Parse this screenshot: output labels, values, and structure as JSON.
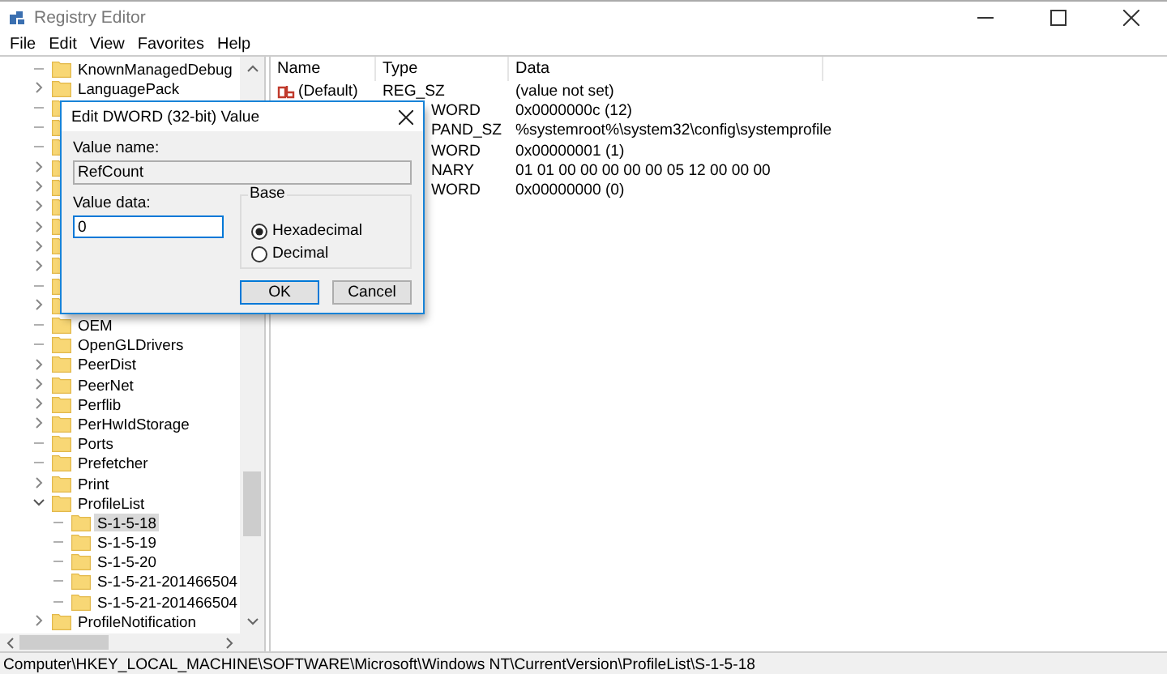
{
  "window": {
    "title": "Registry Editor"
  },
  "menu": [
    "File",
    "Edit",
    "View",
    "Favorites",
    "Help"
  ],
  "tree": {
    "items": [
      {
        "label": "KnownManagedDebug",
        "expandable": false,
        "selected": false
      },
      {
        "label": "LanguagePack",
        "expandable": true,
        "expanded": false,
        "selected": false
      },
      {
        "expandable": false,
        "selected": false
      },
      {
        "expandable": false,
        "selected": false
      },
      {
        "expandable": false,
        "selected": false
      },
      {
        "expandable": true,
        "expanded": false,
        "selected": false
      },
      {
        "expandable": true,
        "expanded": false,
        "selected": false
      },
      {
        "expandable": true,
        "expanded": false,
        "selected": false
      },
      {
        "expandable": true,
        "expanded": false,
        "selected": false
      },
      {
        "expandable": true,
        "expanded": false,
        "selected": false
      },
      {
        "expandable": true,
        "expanded": false,
        "selected": false
      },
      {
        "expandable": false,
        "selected": false
      },
      {
        "expandable": true,
        "expanded": false,
        "selected": false
      },
      {
        "label": "OEM",
        "expandable": false,
        "selected": false
      },
      {
        "label": "OpenGLDrivers",
        "expandable": false,
        "selected": false
      },
      {
        "label": "PeerDist",
        "expandable": true,
        "expanded": false,
        "selected": false
      },
      {
        "label": "PeerNet",
        "expandable": true,
        "expanded": false,
        "selected": false
      },
      {
        "label": "Perflib",
        "expandable": true,
        "expanded": false,
        "selected": false
      },
      {
        "label": "PerHwIdStorage",
        "expandable": true,
        "expanded": false,
        "selected": false
      },
      {
        "label": "Ports",
        "expandable": false,
        "selected": false
      },
      {
        "label": "Prefetcher",
        "expandable": false,
        "selected": false
      },
      {
        "label": "Print",
        "expandable": true,
        "expanded": false,
        "selected": false
      },
      {
        "label": "ProfileList",
        "expandable": true,
        "expanded": true,
        "selected": false,
        "children": [
          {
            "label": "S-1-5-18",
            "expandable": false,
            "selected": true
          },
          {
            "label": "S-1-5-19",
            "expandable": false,
            "selected": false
          },
          {
            "label": "S-1-5-20",
            "expandable": false,
            "selected": false
          },
          {
            "label": "S-1-5-21-201466504",
            "expandable": false,
            "selected": false
          },
          {
            "label": "S-1-5-21-201466504",
            "expandable": false,
            "selected": false
          }
        ]
      },
      {
        "label": "ProfileNotification",
        "expandable": true,
        "expanded": false,
        "selected": false
      }
    ]
  },
  "values": {
    "columns": [
      "Name",
      "Type",
      "Data"
    ],
    "rows": [
      {
        "name": "(Default)",
        "kind": "string",
        "type": "REG_SZ",
        "data": "(value not set)"
      },
      {
        "type": "WORD",
        "data": "0x0000000c (12)"
      },
      {
        "type": "PAND_SZ",
        "data": "%systemroot%\\system32\\config\\systemprofile"
      },
      {
        "type": "WORD",
        "data": "0x00000001 (1)"
      },
      {
        "type": "NARY",
        "data": "01 01 00 00 00 00 00 05 12 00 00 00"
      },
      {
        "type": "WORD",
        "data": "0x00000000 (0)"
      }
    ]
  },
  "dialog": {
    "title": "Edit DWORD (32-bit) Value",
    "name_label": "Value name:",
    "name_value": "RefCount",
    "data_label": "Value data:",
    "data_value": "0",
    "base_label": "Base",
    "bases": [
      {
        "label": "Hexadecimal",
        "selected": true
      },
      {
        "label": "Decimal",
        "selected": false
      }
    ],
    "buttons": [
      "OK",
      "Cancel"
    ]
  },
  "status_bar": "Computer\\HKEY_LOCAL_MACHINE\\SOFTWARE\\Microsoft\\Windows NT\\CurrentVersion\\ProfileList\\S-1-5-18"
}
